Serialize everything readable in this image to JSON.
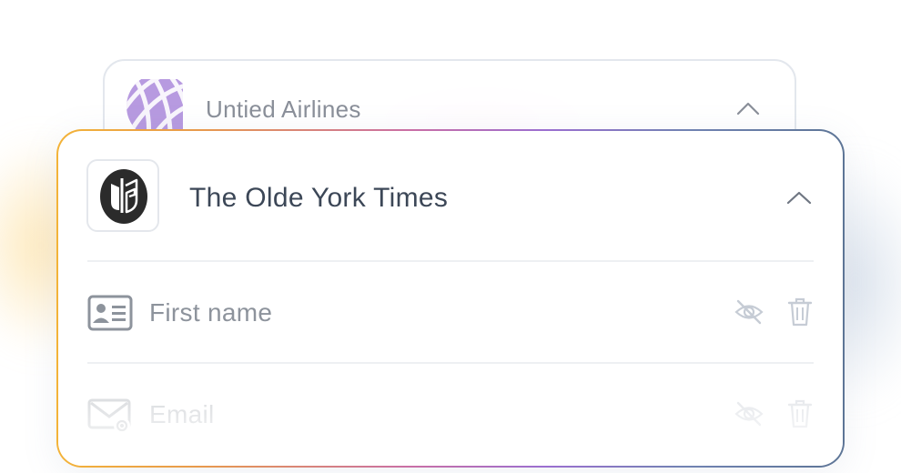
{
  "back_card": {
    "title": "Untied Airlines",
    "logo_icon": "globe-grid-icon",
    "chevron_icon": "chevron-up-icon"
  },
  "front_card": {
    "title": "The Olde York Times",
    "logo_icon": "newspaper-logo-icon",
    "chevron_icon": "chevron-up-icon",
    "fields": [
      {
        "label": "First name",
        "icon": "id-card-icon",
        "visibility_icon": "eye-off-icon",
        "delete_icon": "trash-icon"
      },
      {
        "label": "Email",
        "icon": "email-at-icon",
        "visibility_icon": "eye-off-icon",
        "delete_icon": "trash-icon"
      }
    ]
  },
  "colors": {
    "gradient_start": "#f3b338",
    "gradient_mid": "#c96fa6",
    "gradient_end": "#5d7596",
    "title_text": "#3c4757",
    "muted_text": "#8d939c",
    "airline_logo": "#b79ae0"
  }
}
